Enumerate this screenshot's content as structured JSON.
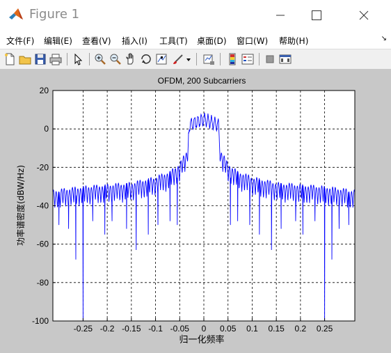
{
  "window": {
    "title": "Figure 1"
  },
  "menu": {
    "items": [
      "文件(F)",
      "编辑(E)",
      "查看(V)",
      "插入(I)",
      "工具(T)",
      "桌面(D)",
      "窗口(W)",
      "帮助(H)"
    ]
  },
  "toolbar": {
    "icons": [
      "new-figure-icon",
      "open-file-icon",
      "save-icon",
      "print-icon",
      "pointer-icon",
      "zoom-in-icon",
      "zoom-out-icon",
      "pan-icon",
      "rotate-3d-icon",
      "data-cursor-icon",
      "brush-icon",
      "link-plot-icon",
      "colorbar-icon",
      "legend-icon",
      "hide-plot-tools-icon",
      "show-plot-tools-icon"
    ]
  },
  "colors": {
    "figure_bg": "#c8c8c8",
    "axes_bg": "#ffffff",
    "line": "#0000ff"
  },
  "chart_data": {
    "type": "line",
    "title": "OFDM, 200 Subcarriers",
    "xlabel": "归一化频率",
    "ylabel": "功率谱密度(dBW/Hz)",
    "xlim": [
      -0.3125,
      0.3125
    ],
    "ylim": [
      -100,
      20
    ],
    "xticks": [
      -0.25,
      -0.2,
      -0.15,
      -0.1,
      -0.05,
      0,
      0.05,
      0.1,
      0.15,
      0.2,
      0.25
    ],
    "xtick_labels": [
      "-0.25",
      "-0.2",
      "-0.15",
      "-0.1",
      "-0.05",
      "0",
      "0.05",
      "0.1",
      "0.15",
      "0.2",
      "0.25"
    ],
    "yticks": [
      -100,
      -80,
      -60,
      -40,
      -20,
      0,
      20
    ],
    "ytick_labels": [
      "-100",
      "-80",
      "-60",
      "-40",
      "-20",
      "0",
      "20"
    ],
    "grid": "dashed",
    "series": [
      {
        "color": "#0000ff",
        "envelope": {
          "x": [
            -0.3125,
            -0.25,
            -0.2,
            -0.15,
            -0.1,
            -0.07,
            -0.05,
            -0.035,
            -0.03,
            0,
            0.03,
            0.035,
            0.05,
            0.07,
            0.1,
            0.15,
            0.2,
            0.25,
            0.3125
          ],
          "y": [
            -31,
            -29,
            -28,
            -27,
            -24,
            -21,
            -17,
            -10,
            3,
            6,
            3,
            -10,
            -17,
            -21,
            -24,
            -27,
            -28,
            -29,
            -31
          ]
        },
        "notches": {
          "x": [
            -0.3,
            -0.28,
            -0.265,
            -0.25,
            -0.23,
            -0.205,
            -0.19,
            -0.16,
            -0.14,
            -0.115,
            -0.095,
            -0.07,
            -0.055,
            0.055,
            0.07,
            0.095,
            0.115,
            0.14,
            0.16,
            0.19,
            0.205,
            0.23,
            0.25,
            0.265,
            0.28,
            0.3
          ],
          "y": [
            -50,
            -52,
            -68,
            -100,
            -48,
            -55,
            -48,
            -52,
            -63,
            -55,
            -50,
            -48,
            -50,
            -50,
            -48,
            -50,
            -55,
            -63,
            -52,
            -48,
            -55,
            -48,
            -100,
            -68,
            -52,
            -50
          ]
        }
      }
    ]
  }
}
